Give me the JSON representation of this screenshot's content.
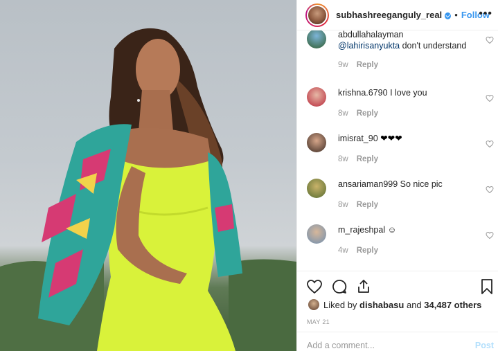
{
  "header": {
    "username": "subhashreeganguly_real",
    "separator": "•",
    "follow_label": "Follow",
    "more_label": "•••"
  },
  "comments": [
    {
      "username": "abdullahalayman",
      "mention": "@lahirisanyukta",
      "text": " don't understand",
      "age": "9w",
      "reply_label": "Reply"
    },
    {
      "username": "krishna.6790",
      "text": "I love you",
      "age": "8w",
      "reply_label": "Reply"
    },
    {
      "username": "imisrat_90",
      "text": "❤❤❤",
      "age": "8w",
      "reply_label": "Reply"
    },
    {
      "username": "ansariaman999",
      "text": "So nice pic",
      "age": "8w",
      "reply_label": "Reply"
    },
    {
      "username": "m_rajeshpal",
      "text": "☺",
      "age": "4w",
      "reply_label": "Reply"
    }
  ],
  "likes": {
    "prefix": "Liked by ",
    "user": "dishabasu",
    "middle": " and ",
    "count": "34,487 others"
  },
  "date": "MAY 21",
  "add_comment": {
    "placeholder": "Add a comment...",
    "post_label": "Post"
  },
  "colors": {
    "link_blue": "#3897f0",
    "mention_blue": "#003569",
    "muted": "#999999",
    "post_disabled": "#b2dffc"
  },
  "icons": [
    "heart-icon",
    "comment-icon",
    "share-icon",
    "bookmark-icon",
    "comment-like-heart-icon"
  ]
}
